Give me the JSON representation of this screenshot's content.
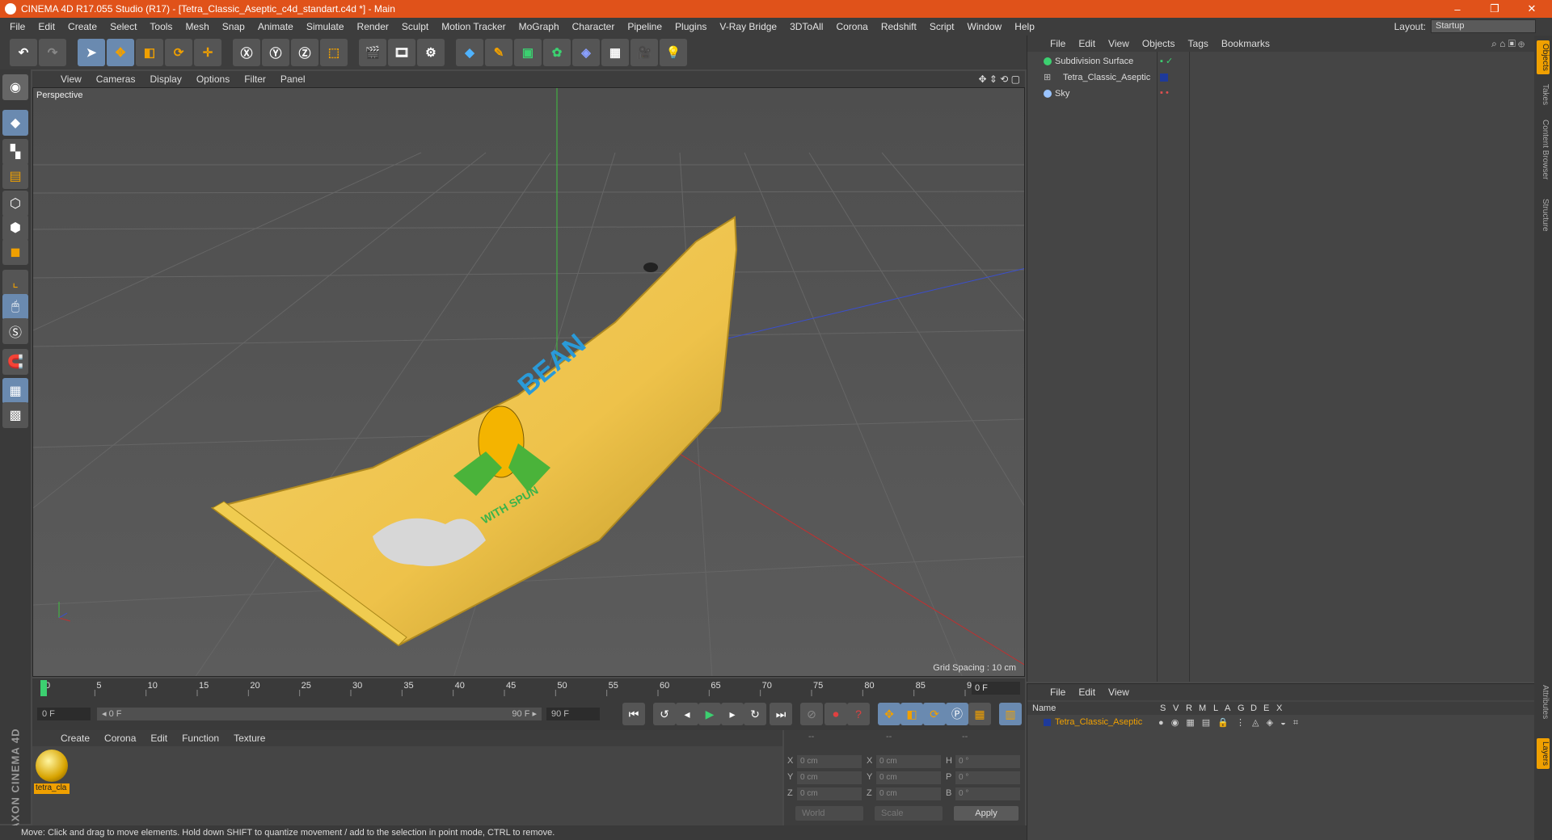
{
  "title": "CINEMA 4D R17.055 Studio (R17) - [Tetra_Classic_Aseptic_c4d_standart.c4d *] - Main",
  "window_controls": {
    "minimize": "–",
    "restore": "❐",
    "close": "✕"
  },
  "menu": [
    "File",
    "Edit",
    "Create",
    "Select",
    "Tools",
    "Mesh",
    "Snap",
    "Animate",
    "Simulate",
    "Render",
    "Sculpt",
    "Motion Tracker",
    "MoGraph",
    "Character",
    "Pipeline",
    "Plugins",
    "V-Ray Bridge",
    "3DToAll",
    "Corona",
    "Redshift",
    "Script",
    "Window",
    "Help"
  ],
  "layout": {
    "label": "Layout:",
    "value": "Startup"
  },
  "viewport": {
    "menu": [
      "View",
      "Cameras",
      "Display",
      "Options",
      "Filter",
      "Panel"
    ],
    "label": "Perspective",
    "grid_spacing": "Grid Spacing : 10 cm",
    "package_text_1": "BEAN",
    "package_text_2": "WITH SPUN"
  },
  "timeline": {
    "ticks": [
      "0",
      "5",
      "10",
      "15",
      "20",
      "25",
      "30",
      "35",
      "40",
      "45",
      "50",
      "55",
      "60",
      "65",
      "70",
      "75",
      "80",
      "85",
      "90"
    ],
    "current_frame": "0 F"
  },
  "playback": {
    "start_field": "0 F",
    "range_start": "◂ 0 F",
    "range_end": "90 F ▸",
    "end_field": "90 F"
  },
  "material": {
    "menu": [
      "Create",
      "Corona",
      "Edit",
      "Function",
      "Texture"
    ],
    "swatch_label": "tetra_cla"
  },
  "brand": "MAXON CINEMA 4D",
  "coords": {
    "headers": [
      "--",
      "--",
      "--"
    ],
    "rows": [
      {
        "a": "X",
        "av": "0 cm",
        "b": "X",
        "bv": "0 cm",
        "c": "H",
        "cv": "0 °"
      },
      {
        "a": "Y",
        "av": "0 cm",
        "b": "Y",
        "bv": "0 cm",
        "c": "P",
        "cv": "0 °"
      },
      {
        "a": "Z",
        "av": "0 cm",
        "b": "Z",
        "bv": "0 cm",
        "c": "B",
        "cv": "0 °"
      }
    ],
    "world": "World",
    "scale": "Scale",
    "apply": "Apply"
  },
  "status": "Move: Click and drag to move elements. Hold down SHIFT to quantize movement / add to the selection in point mode, CTRL to remove.",
  "objects": {
    "menu": [
      "File",
      "Edit",
      "View",
      "Objects",
      "Tags",
      "Bookmarks"
    ],
    "items": [
      {
        "name": "Subdivision Surface"
      },
      {
        "name": "Tetra_Classic_Aseptic"
      },
      {
        "name": "Sky"
      }
    ]
  },
  "layers": {
    "menu": [
      "File",
      "Edit",
      "View"
    ],
    "columns": [
      "Name",
      "S",
      "V",
      "R",
      "M",
      "L",
      "A",
      "G",
      "D",
      "E",
      "X"
    ],
    "rows": [
      {
        "name": "Tetra_Classic_Aseptic"
      }
    ]
  },
  "right_tabs": [
    "Objects",
    "Takes",
    "Content Browser",
    "Structure",
    "Attributes",
    "Layers"
  ],
  "colors": {
    "accent": "#f0a000",
    "title": "#e0521a",
    "selected": "#6a8ab0"
  }
}
